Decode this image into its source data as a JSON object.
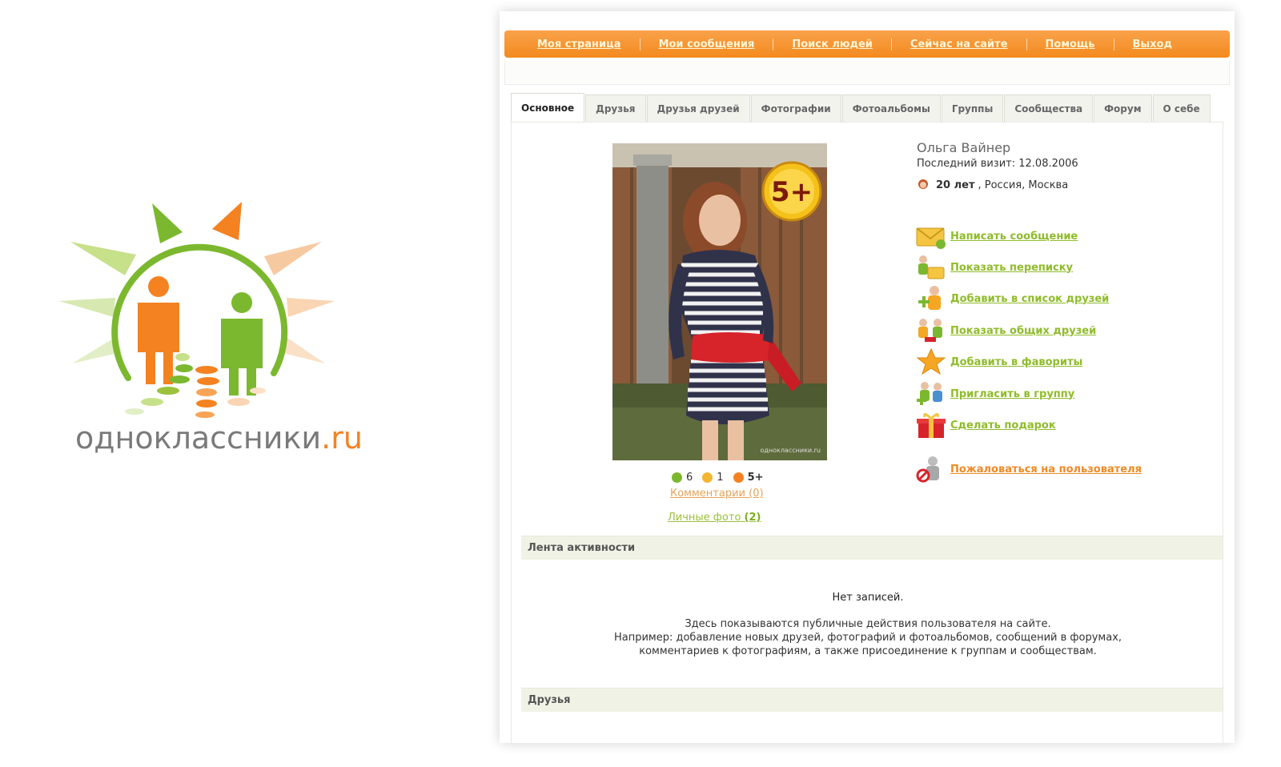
{
  "logo": {
    "text_main": "одноклассники",
    "text_tld": ".ru",
    "colors": {
      "orange": "#f58220",
      "green": "#7cb82f",
      "light_green": "#c7e08a",
      "light_orange": "#f7c9a0",
      "gray": "#7a7a7a"
    }
  },
  "topnav": {
    "items": [
      "Моя страница",
      "Мои сообщения",
      "Поиск людей",
      "Сейчас на сайте",
      "Помощь",
      "Выход"
    ]
  },
  "tabs": [
    "Основное",
    "Друзья",
    "Друзья друзей",
    "Фотографии",
    "Фотоальбомы",
    "Группы",
    "Сообщества",
    "Форум",
    "О себе"
  ],
  "profile": {
    "name": "Ольга Вайнер",
    "last_visit": "Последний визит: 12.08.2006",
    "age": "20 лет",
    "location": ", Россия, Москва",
    "photo_badge": "5+",
    "photo_watermark": "одноклассники.ru",
    "ratings": [
      {
        "icon": "green-rating-icon",
        "color": "#7cb82f",
        "value": "6"
      },
      {
        "icon": "yellow-rating-icon",
        "color": "#f2b632",
        "value": "1"
      },
      {
        "icon": "orange-rating-icon",
        "color": "#f58220",
        "value": "5+"
      }
    ],
    "comments_link": "Комментарии (0)",
    "personal_photos_label": "Личные фото",
    "personal_photos_count": "(2)"
  },
  "actions": [
    {
      "icon": "envelope-icon",
      "label": "Написать сообщение"
    },
    {
      "icon": "conversation-icon",
      "label": "Показать переписку"
    },
    {
      "icon": "add-friend-icon",
      "label": "Добавить в список друзей"
    },
    {
      "icon": "mutual-friends-icon",
      "label": "Показать общих друзей"
    },
    {
      "icon": "star-icon",
      "label": "Добавить в фавориты"
    },
    {
      "icon": "invite-group-icon",
      "label": "Пригласить в группу"
    },
    {
      "icon": "gift-icon",
      "label": "Сделать подарок"
    },
    {
      "icon": "report-user-icon",
      "label": "Пожаловаться на пользователя"
    }
  ],
  "activity": {
    "title": "Лента активности",
    "empty": "Нет записей.",
    "desc_line1": "Здесь показываются публичные действия пользователя на сайте.",
    "desc_line2": "Например: добавление новых друзей, фотографий и фотоальбомов, сообщений в форумах,",
    "desc_line3": "комментариев к фотографиям, а также присоединение к группам и сообществам."
  },
  "friends_section": {
    "title": "Друзья"
  }
}
